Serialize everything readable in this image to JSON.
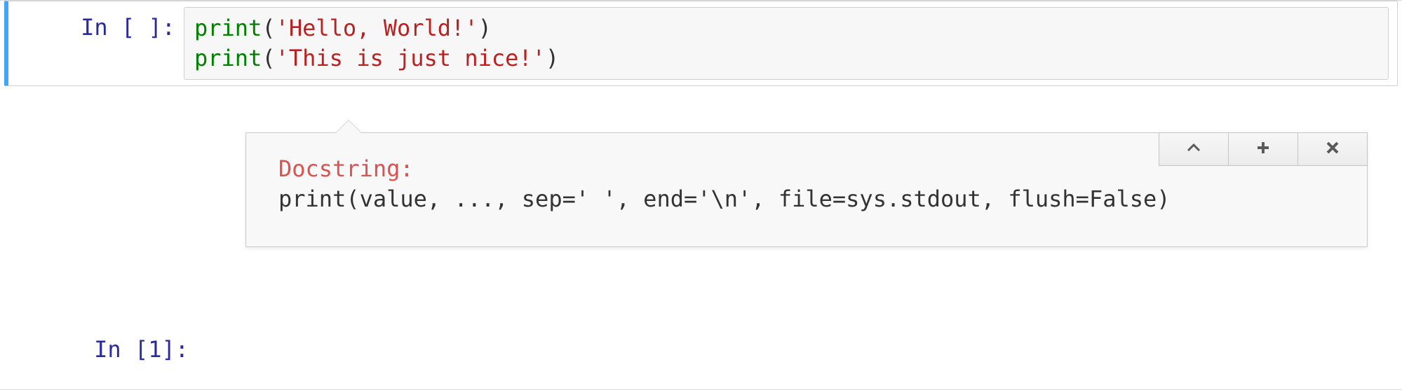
{
  "cell1": {
    "prompt_label": "In [ ]:",
    "code_line1": {
      "fn": "print",
      "open": "(",
      "str": "'Hello, World!'",
      "close": ")"
    },
    "code_line2": {
      "fn": "print",
      "open": "(",
      "str": "'This is just nice!'",
      "close": ")"
    }
  },
  "tooltip": {
    "doclabel": "Docstring:",
    "signature": "print(value, ..., sep=' ', end='\\n', file=sys.stdout, flush=False)"
  },
  "cell2": {
    "prompt_label": "In [1]:"
  }
}
